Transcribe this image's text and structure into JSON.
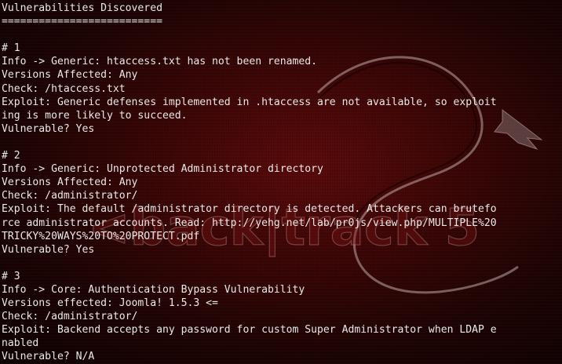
{
  "terminal": {
    "background_accent": "#5a0a0a",
    "text_color": "#e9e9e9",
    "wallpaper_text": "<back|track 5",
    "lines": [
      "Vulnerabilities Discovered",
      "==========================",
      "",
      "# 1",
      "Info -> Generic: htaccess.txt has not been renamed.",
      "Versions Affected: Any",
      "Check: /htaccess.txt",
      "Exploit: Generic defenses implemented in .htaccess are not available, so exploit",
      "ing is more likely to succeed.",
      "Vulnerable? Yes",
      "",
      "# 2",
      "Info -> Generic: Unprotected Administrator directory",
      "Versions Affected: Any",
      "Check: /administrator/",
      "Exploit: The default /administrator directory is detected. Attackers can brutefo",
      "rce administrator accounts. Read: http://yehg.net/lab/pr0js/view.php/MULTIPLE%20",
      "TRICKY%20WAYS%20TO%20PROTECT.pdf",
      "Vulnerable? Yes",
      "",
      "# 3",
      "Info -> Core: Authentication Bypass Vulnerability",
      "Versions effected: Joomla! 1.5.3 <=",
      "Check: /administrator/",
      "Exploit: Backend accepts any password for custom Super Administrator when LDAP e",
      "nabled",
      "Vulnerable? N/A"
    ]
  }
}
